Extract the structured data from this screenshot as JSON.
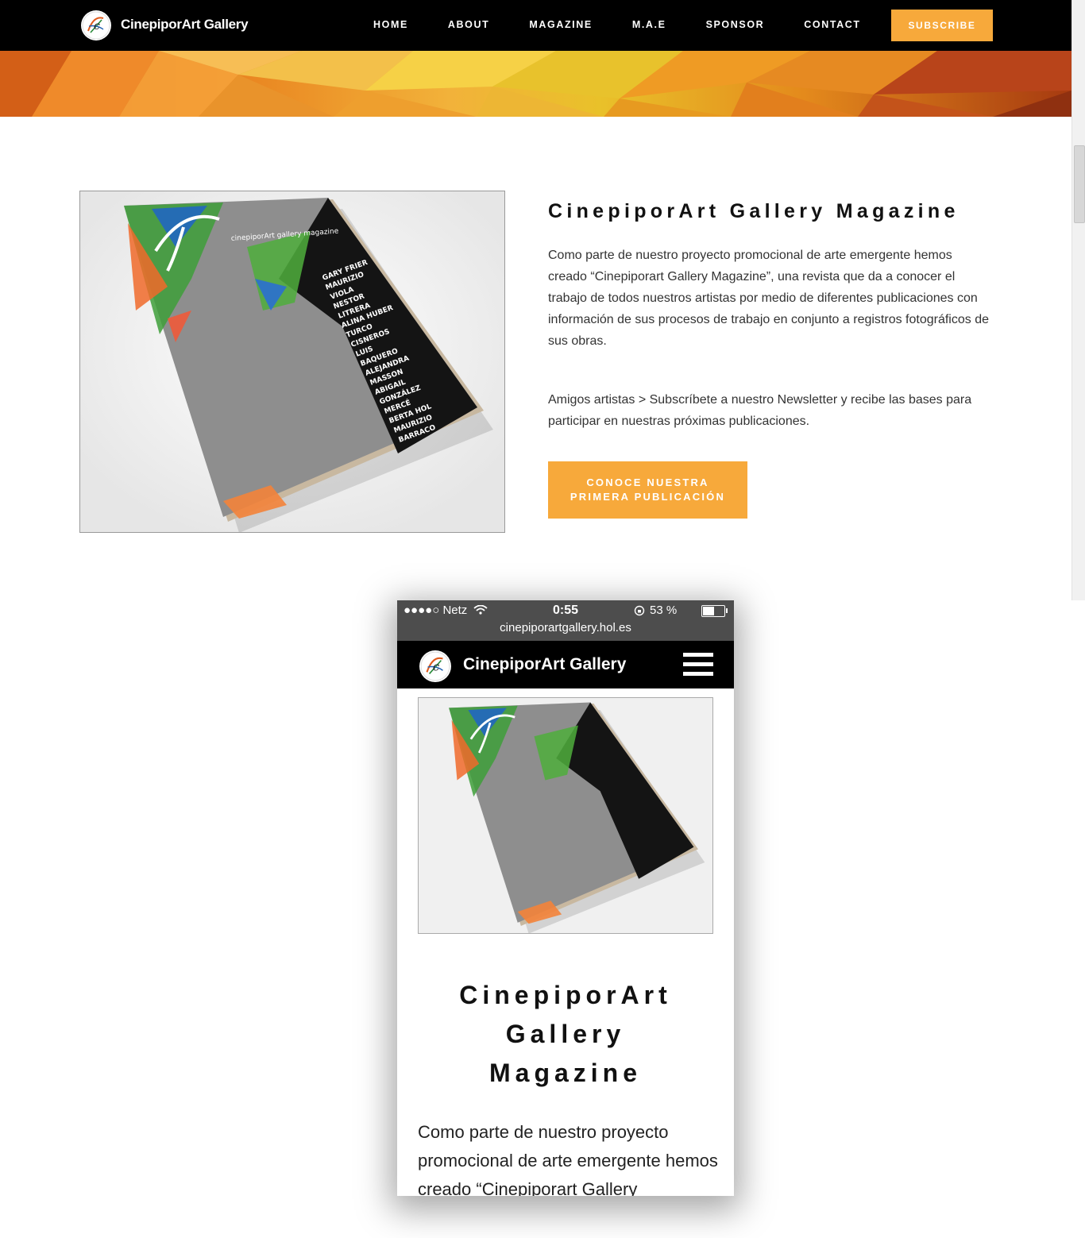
{
  "header": {
    "brand": "CinepiporArt Gallery",
    "menu": [
      "HOME",
      "ABOUT",
      "MAGAZINE",
      "M.A.E",
      "SPONSOR",
      "CONTACT"
    ],
    "subscribe_label": "SUBSCRIBE"
  },
  "magazine_cover": {
    "masthead": "cinepiporArt gallery magazine",
    "artists": [
      "GARY FRIER",
      "MAURIZIO",
      "VIOLA",
      "NESTOR",
      "LITRERA",
      "ALINA HUBER",
      "TURCO",
      "CISNEROS",
      "LUIS",
      "BAQUERO",
      "ALEJANDRA",
      "MASSON",
      "ABIGAIL",
      "GONZÁLEZ",
      "MERCÉ",
      "BERTA HOL",
      "MAURIZIO",
      "BARRACO"
    ]
  },
  "section": {
    "title": "CinepiporArt Gallery Magazine",
    "paragraph1": "Como parte de nuestro proyecto promocional de arte emergente hemos creado “Cinepiporart Gallery Magazine”, una revista que da a conocer el trabajo de todos nuestros artistas por medio de diferentes publicaciones con información de sus procesos de trabajo en conjunto a registros fotográficos de sus obras.",
    "paragraph2": "Amigos artistas > Subscríbete a nuestro Newsletter y recibe las bases para participar en nuestras próximas publicaciones.",
    "cta_line1": "CONOCE NUESTRA",
    "cta_line2": "PRIMERA PUBLICACIÓN"
  },
  "phone": {
    "carrier": "●●●●○ Netz",
    "time": "0:55",
    "battery_text": "53 %",
    "battery_level": 0.53,
    "url": "cinepiporartgallery.hol.es",
    "brand": "CinepiporArt Gallery",
    "title_line1": "CinepiporArt",
    "title_line2": "Gallery",
    "title_line3": "Magazine",
    "text": "Como parte de nuestro proyecto promocional de arte emergente hemos creado “Cinepiporart Gallery"
  },
  "colors": {
    "accent": "#f7a93b",
    "nav_bg": "#000000",
    "status_bar": "#4d4d4d"
  }
}
